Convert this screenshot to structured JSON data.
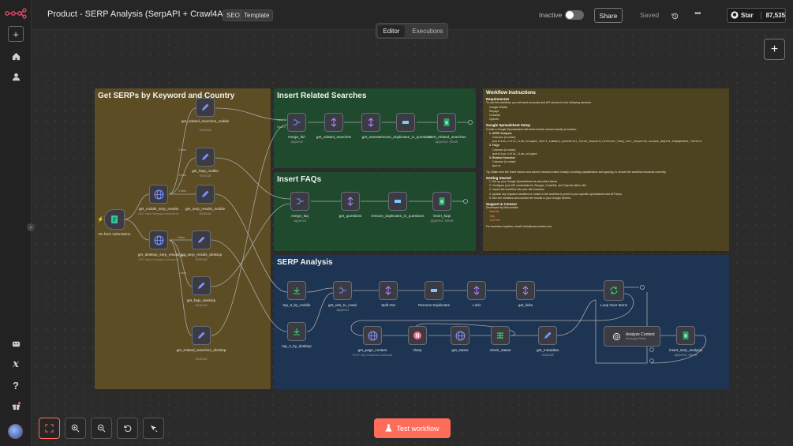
{
  "header": {
    "title": "Product - SERP Analysis (SerpAPI + Crawl4AI)",
    "tags": [
      "SEO",
      "Template"
    ],
    "status_label": "Inactive",
    "share_label": "Share",
    "saved_label": "Saved",
    "star_label": "Star",
    "star_count": "87,535"
  },
  "tabs": [
    "Editor",
    "Executions"
  ],
  "stickies": {
    "serps": "Get SERPs by Keyword and Country",
    "related": "Insert Related Searches",
    "faqs": "Insert FAQs",
    "analysis": "SERP Analysis"
  },
  "nodes": {
    "trigger": "On form submission",
    "mobile": "get_mobile_serp_results",
    "mobile_sub": "GET: https://serpapi.com/search",
    "desktop": "get_desktop_serp_results",
    "desktop_sub": "GET: https://serpapi.com/search",
    "rel_mobile": "get_related_searches_mobile",
    "rel_mobile_sub": "manual",
    "faqs_mobile": "get_faqs_mobile",
    "faqs_mobile_sub": "manual",
    "serp_mobile": "get_serp_results_mobile",
    "serp_mobile_sub": "manual",
    "serp_desktop": "get_serp_results_desktop",
    "serp_desktop_sub": "manual",
    "faqs_desktop": "get_faqs_desktop",
    "faqs_desktop_sub": "manual",
    "rel_desktop": "get_related_searches_desktop",
    "rel_desktop_sub": "manual",
    "merge_fs": "merge_fs/r",
    "merge_fs_sub": "append",
    "get_rel": "get_related_searches",
    "get_names": "get_names",
    "remove_dup_q": "remove_duplicates_in_questions",
    "insert_rel": "insert_related_searches",
    "insert_rel_sub": "append: sheet",
    "merge_faq": "merge_faq",
    "merge_faq_sub": "append",
    "get_questions": "get_questions",
    "remove_dup_q2": "remove_duplicates_in_questions",
    "insert_faqs": "insert_faqs",
    "insert_faqs_sub": "append: sheet",
    "top3_mobile": "top_3_by_mobile",
    "top3_desktop": "top_3_by_desktop",
    "get_urls": "get_urls_to_crawl",
    "get_urls_sub": "append",
    "split_out": "Split Out",
    "remove_dups": "Remove Duplicates",
    "limit": "Limit",
    "get_links": "get_links",
    "loop": "Loop Over Items",
    "get_page": "get_page_content",
    "get_page_sub": "POST: http://crawl4ai:11235/crawl",
    "sleep": "sleep",
    "get_status": "get_status",
    "check_status": "check_status",
    "get_metadata": "get_metadata",
    "get_metadata_sub": "manual",
    "analyze": "Analyze Content",
    "analyze_sub": "Message Model",
    "insert_analysis": "insert_serp_analysis",
    "insert_analysis_sub": "append: sheet"
  },
  "instructions": {
    "title": "Workflow Instructions",
    "req_h": "Requirements",
    "req_text": "To use this workflow, you will need accounts and API access for the following services:",
    "req_items": [
      "Google Sheets",
      "Serpapi",
      "Crawl4AI",
      "OpenAI"
    ],
    "setup_h": "Google Spreadsheet Setup",
    "setup_text": "Create a Google Spreadsheet with three sheets named exactly as follows:",
    "sheet1": "1. SERP Analysis",
    "sheet1_cols": "Columns (in order):",
    "sheet1_vals": "position,title,link,snippet,short_summary,potential_focus_keyword,relevant_long_tail_keywords,unique_angles,engagement_factors",
    "sheet2": "2. FAQs",
    "sheet2_cols": "Columns (in order):",
    "sheet2_vals": "question,title,link,snippet",
    "sheet3": "3. Related Searches",
    "sheet3_cols": "Columns (in order):",
    "sheet3_vals": "query",
    "tip": "Tip: Make sure the sheet names and column headers match exactly, including capitalization and spacing, to ensure the workflow functions correctly.",
    "start_h": "Getting Started",
    "steps": [
      "1. Set up your Google Spreadsheet as described above.",
      "2. Configure your API credentials for Serpapi, Crawl4AI, and OpenAI within n8n.",
      "3. Import the workflow into your n8n instance.",
      "4. Update any required variables or nodes in the workflow to point to your specific spreadsheet and API keys.",
      "5. Run the workflow and monitor the results in your Google Sheets."
    ],
    "support_h": "Support & Contact",
    "dev_text": "Developed by Marvomatic",
    "links": [
      "Website",
      "Tally",
      "YouTube"
    ],
    "contact": "For business inquiries, email: hello@marvomatic.com"
  },
  "conn_labels": [
    "1 item",
    "1 item",
    "1 item",
    "1 item",
    "1 item",
    "1 item",
    "Input 1",
    "Input 2"
  ],
  "test_button": "Test workflow",
  "colors": {
    "accent": "#ff6d5a",
    "serp_sticky": "#5c4d24",
    "green_sticky": "#1f4a2e",
    "blue_sticky": "#1d3552",
    "instr_sticky": "#4d4321"
  }
}
